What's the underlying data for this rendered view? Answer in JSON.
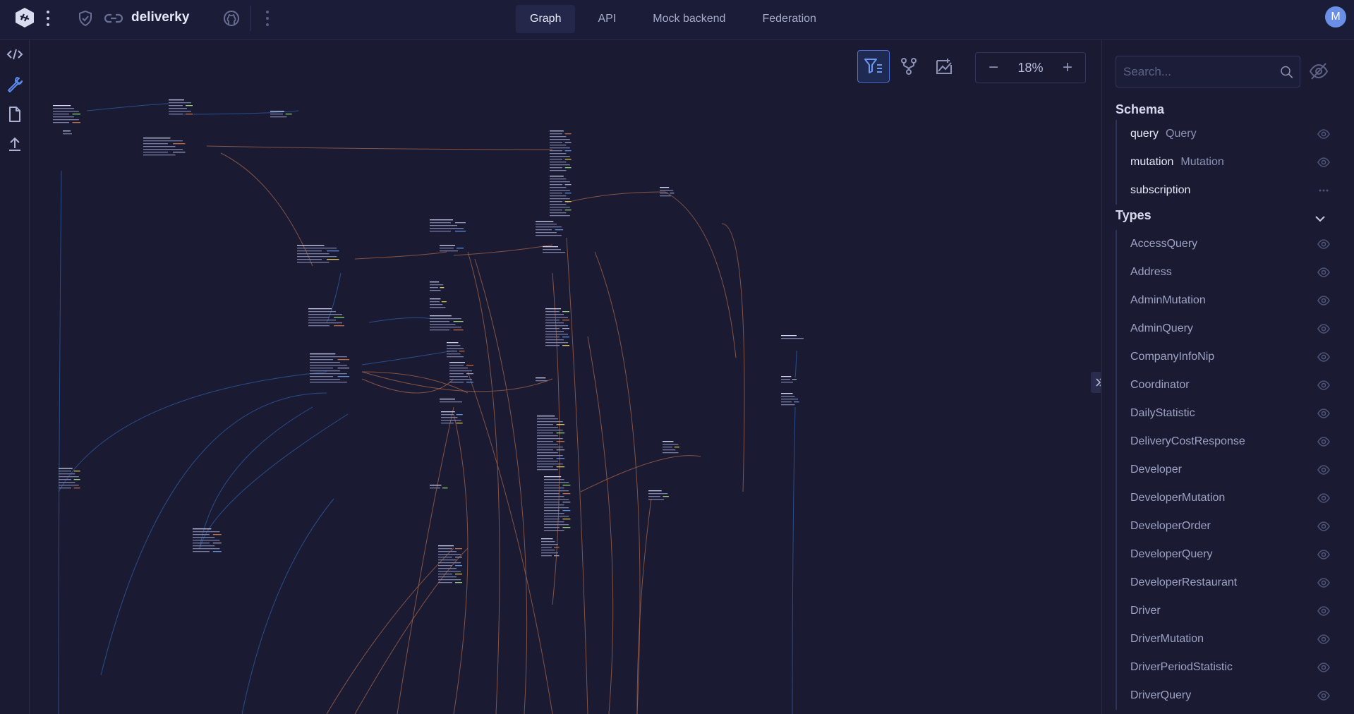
{
  "app": {
    "project_name": "deliverky",
    "user_initial": "M"
  },
  "nav": {
    "tabs": [
      "Graph",
      "API",
      "Mock backend",
      "Federation"
    ],
    "active_tab": "Graph"
  },
  "toolbar": {
    "zoom_label": "18%",
    "zoom_out": "−",
    "zoom_in": "+"
  },
  "sidebar": {
    "search_placeholder": "Search...",
    "schema_title": "Schema",
    "schema_rows": [
      {
        "name": "query",
        "type": "Query",
        "icon": "eye-icon"
      },
      {
        "name": "mutation",
        "type": "Mutation",
        "icon": "eye-icon"
      },
      {
        "name": "subscription",
        "type": "",
        "icon": "more-icon"
      }
    ],
    "types_title": "Types",
    "types": [
      "AccessQuery",
      "Address",
      "AdminMutation",
      "AdminQuery",
      "CompanyInfoNip",
      "Coordinator",
      "DailyStatistic",
      "DeliveryCostResponse",
      "Developer",
      "DeveloperMutation",
      "DeveloperOrder",
      "DeveloperQuery",
      "DeveloperRestaurant",
      "Driver",
      "DriverMutation",
      "DriverPeriodStatistic",
      "DriverQuery"
    ]
  },
  "colors": {
    "background": "#1a1b33",
    "accent": "#4b6fd8",
    "edge_blue": "#2f5fa8",
    "edge_orange": "#a8654a"
  }
}
